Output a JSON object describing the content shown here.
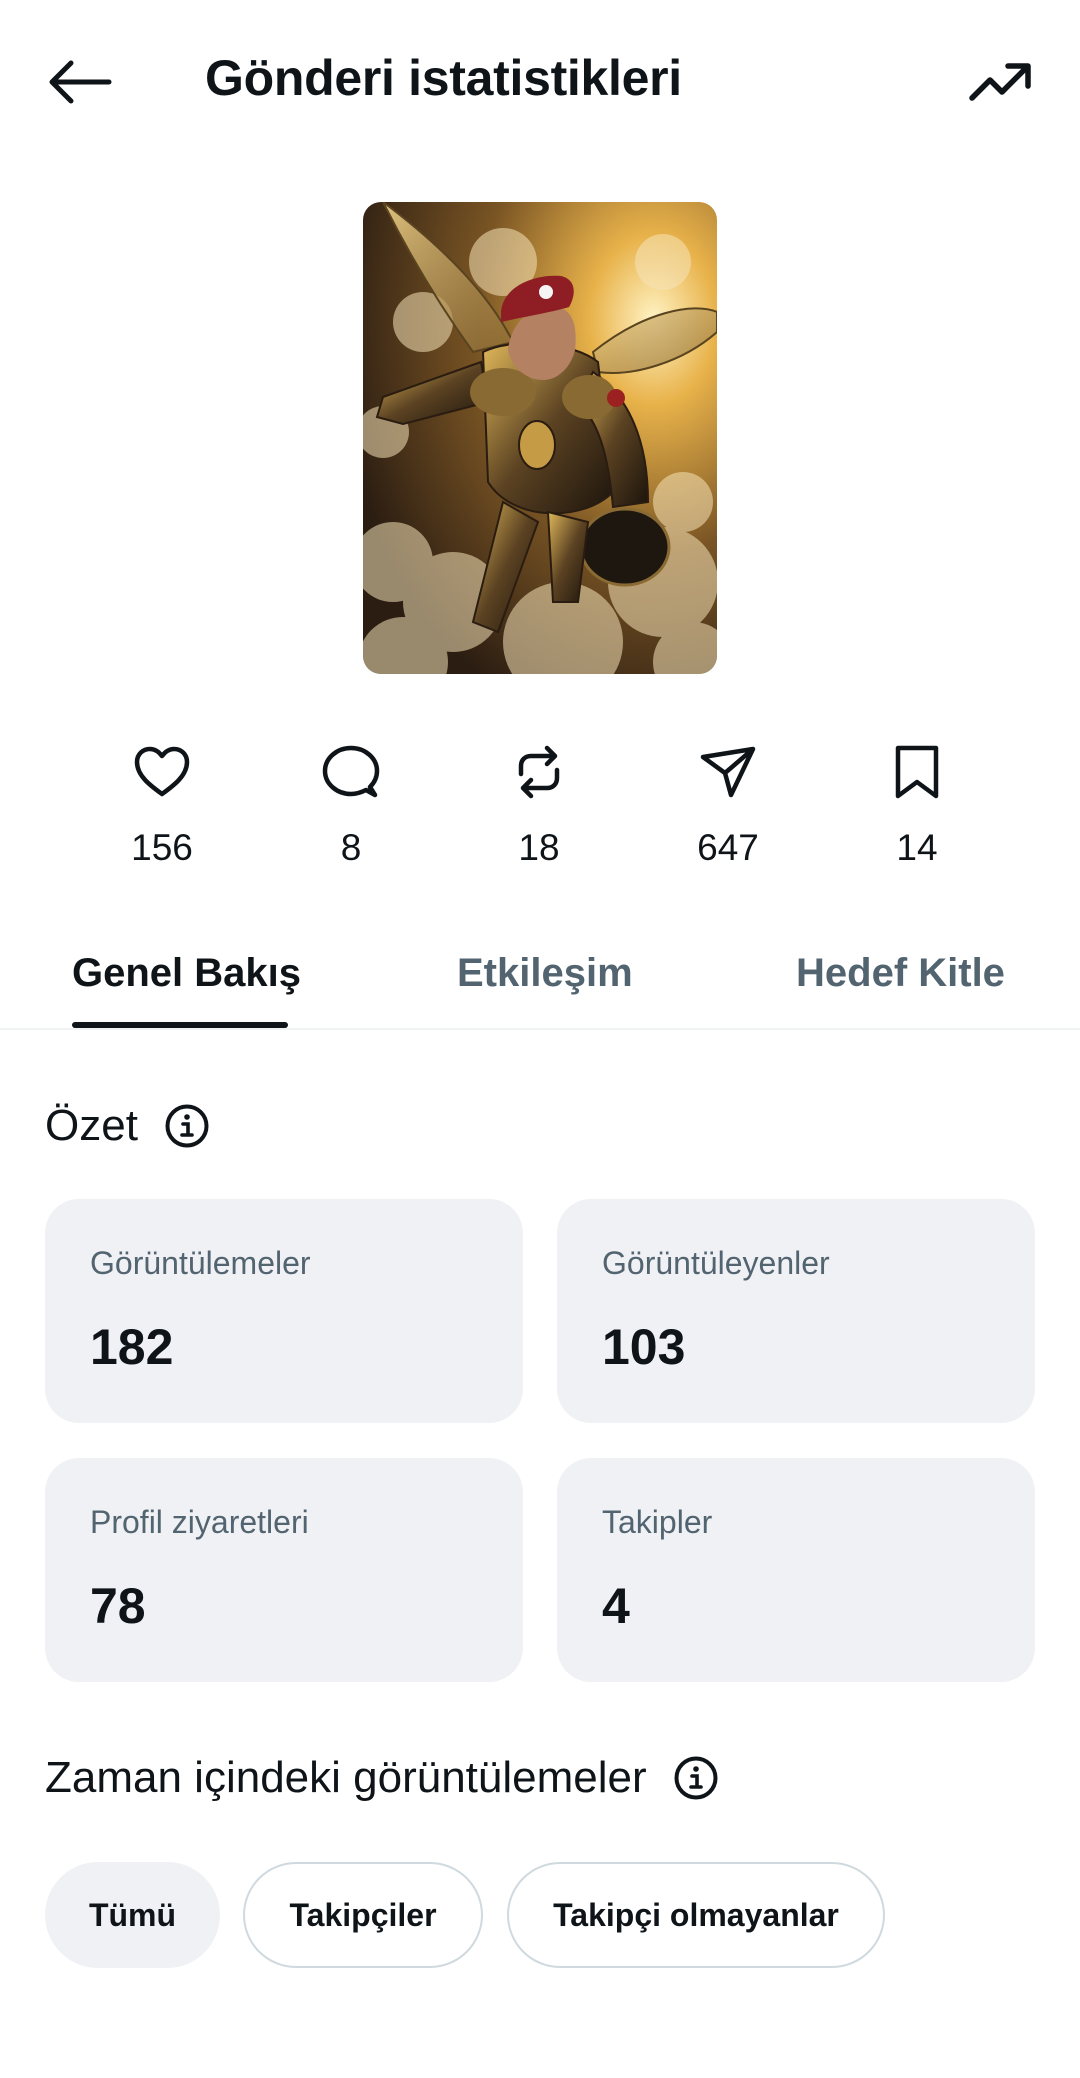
{
  "header": {
    "title": "Gönderi istatistikleri",
    "back_icon": "arrow-left-icon",
    "trend_icon": "trending-up-icon"
  },
  "post": {
    "image_alt": "Illustration of a winged armored soldier in a red beret flying above golden clouds"
  },
  "metrics": [
    {
      "name": "likes",
      "icon": "heart-icon",
      "value": "156"
    },
    {
      "name": "replies",
      "icon": "comment-icon",
      "value": "8"
    },
    {
      "name": "reposts",
      "icon": "repost-icon",
      "value": "18"
    },
    {
      "name": "shares",
      "icon": "send-icon",
      "value": "647"
    },
    {
      "name": "bookmarks",
      "icon": "bookmark-icon",
      "value": "14"
    }
  ],
  "tabs": [
    {
      "label": "Genel Bakış",
      "active": true
    },
    {
      "label": "Etkileşim",
      "active": false
    },
    {
      "label": "Hedef Kitle",
      "active": false
    }
  ],
  "summary": {
    "title": "Özet",
    "cards": [
      {
        "label": "Görüntülemeler",
        "value": "182"
      },
      {
        "label": "Görüntüleyenler",
        "value": "103"
      },
      {
        "label": "Profil ziyaretleri",
        "value": "78"
      },
      {
        "label": "Takipler",
        "value": "4"
      }
    ]
  },
  "views_over_time": {
    "title": "Zaman içindeki görüntülemeler",
    "filters": [
      {
        "label": "Tümü",
        "selected": true
      },
      {
        "label": "Takipçiler",
        "selected": false
      },
      {
        "label": "Takipçi olmayanlar",
        "selected": false
      }
    ]
  },
  "colors": {
    "text": "#0f1419",
    "muted": "#536471",
    "card_bg": "#f0f1f4",
    "border": "#cfd9de"
  }
}
